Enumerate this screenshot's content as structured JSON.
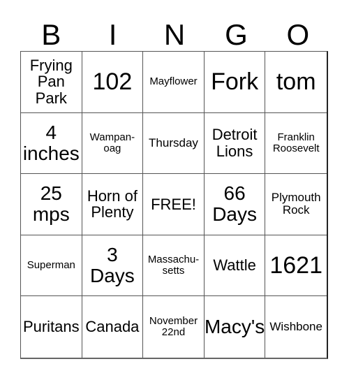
{
  "header": {
    "letters": [
      "B",
      "I",
      "N",
      "G",
      "O"
    ]
  },
  "cells": [
    {
      "text": "Frying\nPan\nPark",
      "size": "s-md"
    },
    {
      "text": "102",
      "size": "s-xl"
    },
    {
      "text": "Mayflower",
      "size": "s-xs"
    },
    {
      "text": "Fork",
      "size": "s-xl"
    },
    {
      "text": "tom",
      "size": "s-xl"
    },
    {
      "text": "4\ninches",
      "size": "s-lg"
    },
    {
      "text": "Wampan-\noag",
      "size": "s-xs"
    },
    {
      "text": "Thursday",
      "size": "s-sm"
    },
    {
      "text": "Detroit\nLions",
      "size": "s-md"
    },
    {
      "text": "Franklin\nRoosevelt",
      "size": "s-xs"
    },
    {
      "text": "25\nmps",
      "size": "s-lg"
    },
    {
      "text": "Horn of\nPlenty",
      "size": "s-md"
    },
    {
      "text": "FREE!",
      "size": "s-md"
    },
    {
      "text": "66\nDays",
      "size": "s-lg"
    },
    {
      "text": "Plymouth\nRock",
      "size": "s-sm"
    },
    {
      "text": "Superman",
      "size": "s-xs"
    },
    {
      "text": "3\nDays",
      "size": "s-lg"
    },
    {
      "text": "Massachu-\nsetts",
      "size": "s-xs"
    },
    {
      "text": "Wattle",
      "size": "s-md"
    },
    {
      "text": "1621",
      "size": "s-xl"
    },
    {
      "text": "Puritans",
      "size": "s-md"
    },
    {
      "text": "Canada",
      "size": "s-md"
    },
    {
      "text": "November\n22nd",
      "size": "s-xs"
    },
    {
      "text": "Macy's",
      "size": "s-lg"
    },
    {
      "text": "Wishbone",
      "size": "s-sm"
    }
  ]
}
